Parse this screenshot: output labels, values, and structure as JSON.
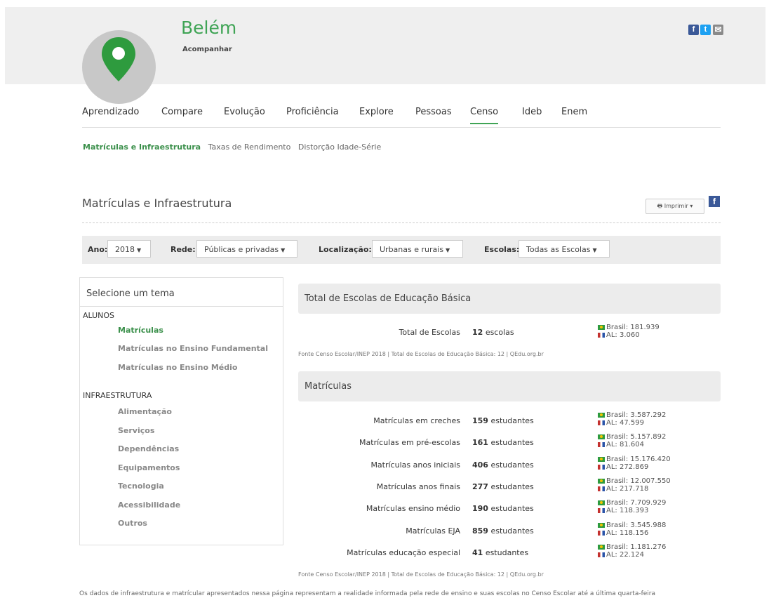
{
  "header": {
    "city": "Belém",
    "follow": "Acompanhar",
    "social": [
      {
        "name": "facebook-icon",
        "glyph": "f",
        "color": "#3b5998"
      },
      {
        "name": "twitter-icon",
        "glyph": "t",
        "color": "#1da1f2"
      },
      {
        "name": "email-icon",
        "glyph": "✉",
        "color": "#888888"
      }
    ],
    "pin_color": "#2e9b3e"
  },
  "tabs": [
    "Aprendizado",
    "Compare",
    "Evolução",
    "Proficiência",
    "Explore",
    "Pessoas",
    "Censo",
    "Ideb",
    "Enem"
  ],
  "active_tab": "Censo",
  "subtabs": [
    "Matrículas e Infraestrutura",
    "Taxas de Rendimento",
    "Distorção Idade-Série"
  ],
  "page_title": "Matrículas e Infraestrutura",
  "print_label": "Imprimir",
  "filters": {
    "ano_label": "Ano:",
    "ano_value": "2018",
    "rede_label": "Rede:",
    "rede_value": "Públicas e privadas",
    "loc_label": "Localização:",
    "loc_value": "Urbanas e rurais",
    "esc_label": "Escolas:",
    "esc_value": "Todas as Escolas"
  },
  "sidebar": {
    "title": "Selecione um tema",
    "group1": "ALUNOS",
    "alunos": [
      "Matrículas",
      "Matrículas no Ensino Fundamental",
      "Matrículas no Ensino Médio"
    ],
    "group2": "INFRAESTRUTURA",
    "infra": [
      "Alimentação",
      "Serviços",
      "Dependências",
      "Equipamentos",
      "Tecnologia",
      "Acessibilidade",
      "Outros"
    ]
  },
  "panel1": {
    "title": "Total de Escolas de Educação Básica",
    "label": "Total de Escolas",
    "value": "12",
    "unit": "escolas",
    "brasil": "Brasil: 181.939",
    "al": "AL: 3.060",
    "source": "Fonte Censo Escolar/INEP 2018 | Total de Escolas de Educação Básica: 12 | QEdu.org.br"
  },
  "panel2": {
    "title": "Matrículas",
    "rows": [
      {
        "label": "Matrículas em creches",
        "value": "159",
        "unit": "estudantes",
        "brasil": "Brasil: 3.587.292",
        "al": "AL: 47.599"
      },
      {
        "label": "Matrículas em pré-escolas",
        "value": "161",
        "unit": "estudantes",
        "brasil": "Brasil: 5.157.892",
        "al": "AL: 81.604"
      },
      {
        "label": "Matrículas anos iniciais",
        "value": "406",
        "unit": "estudantes",
        "brasil": "Brasil: 15.176.420",
        "al": "AL: 272.869"
      },
      {
        "label": "Matrículas anos finais",
        "value": "277",
        "unit": "estudantes",
        "brasil": "Brasil: 12.007.550",
        "al": "AL: 217.718"
      },
      {
        "label": "Matrículas ensino médio",
        "value": "190",
        "unit": "estudantes",
        "brasil": "Brasil: 7.709.929",
        "al": "AL: 118.393"
      },
      {
        "label": "Matrículas EJA",
        "value": "859",
        "unit": "estudantes",
        "brasil": "Brasil: 3.545.988",
        "al": "AL: 118.156"
      },
      {
        "label": "Matrículas educação especial",
        "value": "41",
        "unit": "estudantes",
        "brasil": "Brasil: 1.181.276",
        "al": "AL: 22.124"
      }
    ],
    "source": "Fonte Censo Escolar/INEP 2018 | Total de Escolas de Educação Básica: 12 | QEdu.org.br"
  },
  "footnote": "Os dados de infraestrutura e matrícular apresentados nessa página representam a realidade informada pela rede de ensino e suas escolas no Censo Escolar até a última quarta-feira"
}
